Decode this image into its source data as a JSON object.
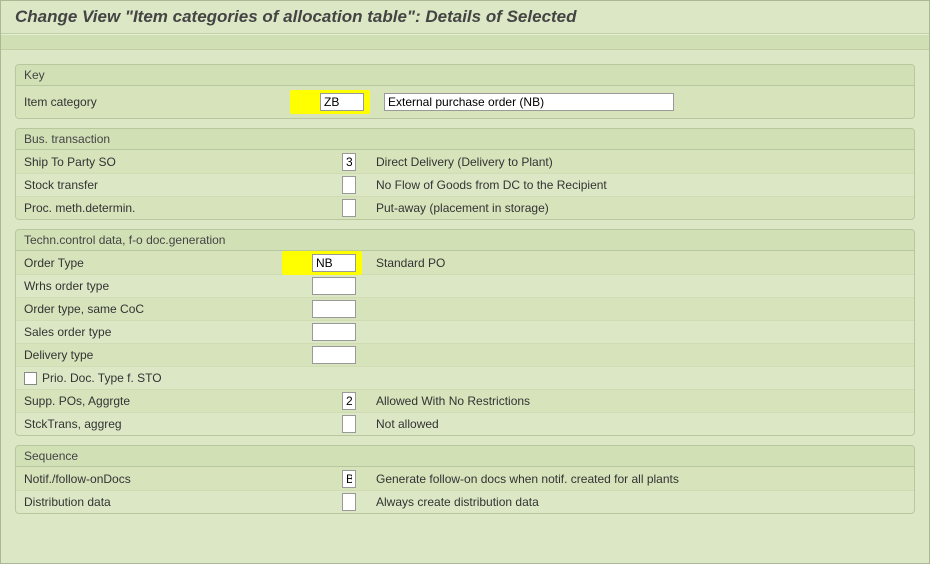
{
  "title": "Change View \"Item categories of allocation table\": Details of Selected",
  "sections": {
    "key": {
      "title": "Key",
      "item_category_label": "Item category",
      "item_category_value": "ZB",
      "item_category_desc": "External purchase order (NB)"
    },
    "bus": {
      "title": "Bus. transaction",
      "ship_label": "Ship To Party SO",
      "ship_value": "3",
      "ship_desc": "Direct Delivery (Delivery to Plant)",
      "stock_label": "Stock transfer",
      "stock_value": "",
      "stock_desc": "No Flow of Goods from DC to the Recipient",
      "proc_label": "Proc. meth.determin.",
      "proc_value": "",
      "proc_desc": "Put-away (placement in storage)"
    },
    "tech": {
      "title": "Techn.control data, f-o doc.generation",
      "order_type_label": "Order Type",
      "order_type_value": "NB",
      "order_type_desc": "Standard PO",
      "wrhs_label": "Wrhs order type",
      "wrhs_value": "",
      "ot_same_label": "Order type, same CoC",
      "ot_same_value": "",
      "sales_label": "Sales order type",
      "sales_value": "",
      "delivery_label": "Delivery type",
      "delivery_value": "",
      "prio_label": "Prio. Doc. Type f. STO",
      "supp_label": "Supp. POs, Aggrgte",
      "supp_value": "2",
      "supp_desc": "Allowed With No Restrictions",
      "stck_label": "StckTrans, aggreg",
      "stck_value": "",
      "stck_desc": "Not allowed"
    },
    "seq": {
      "title": "Sequence",
      "notif_label": "Notif./follow-onDocs",
      "notif_value": "B",
      "notif_desc": "Generate follow-on docs when notif. created for all plants",
      "dist_label": "Distribution data",
      "dist_value": "",
      "dist_desc": "Always create distribution data"
    }
  }
}
